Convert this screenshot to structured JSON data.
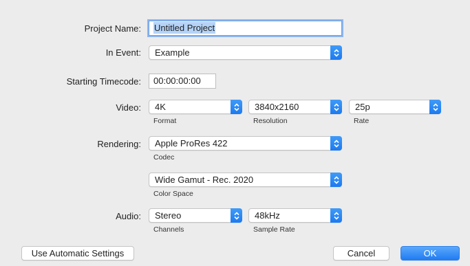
{
  "labels": {
    "project_name": "Project Name:",
    "in_event": "In Event:",
    "starting_timecode": "Starting Timecode:",
    "video": "Video:",
    "rendering": "Rendering:",
    "audio": "Audio:"
  },
  "fields": {
    "project_name_value": "Untitled Project",
    "timecode_value": "00:00:00:00"
  },
  "popups": {
    "event": "Example",
    "video_format": "4K",
    "video_resolution": "3840x2160",
    "video_rate": "25p",
    "codec": "Apple ProRes 422",
    "color_space": "Wide Gamut - Rec. 2020",
    "audio_channels": "Stereo",
    "audio_sample_rate": "48kHz"
  },
  "captions": {
    "format": "Format",
    "resolution": "Resolution",
    "rate": "Rate",
    "codec": "Codec",
    "color_space": "Color Space",
    "channels": "Channels",
    "sample_rate": "Sample Rate"
  },
  "buttons": {
    "use_automatic_settings": "Use Automatic Settings",
    "cancel": "Cancel",
    "ok": "OK"
  },
  "colors": {
    "accent": "#1c7af1",
    "background": "#ececec"
  },
  "icons": {
    "popup_stepper": "up-down-chevron-icon"
  }
}
